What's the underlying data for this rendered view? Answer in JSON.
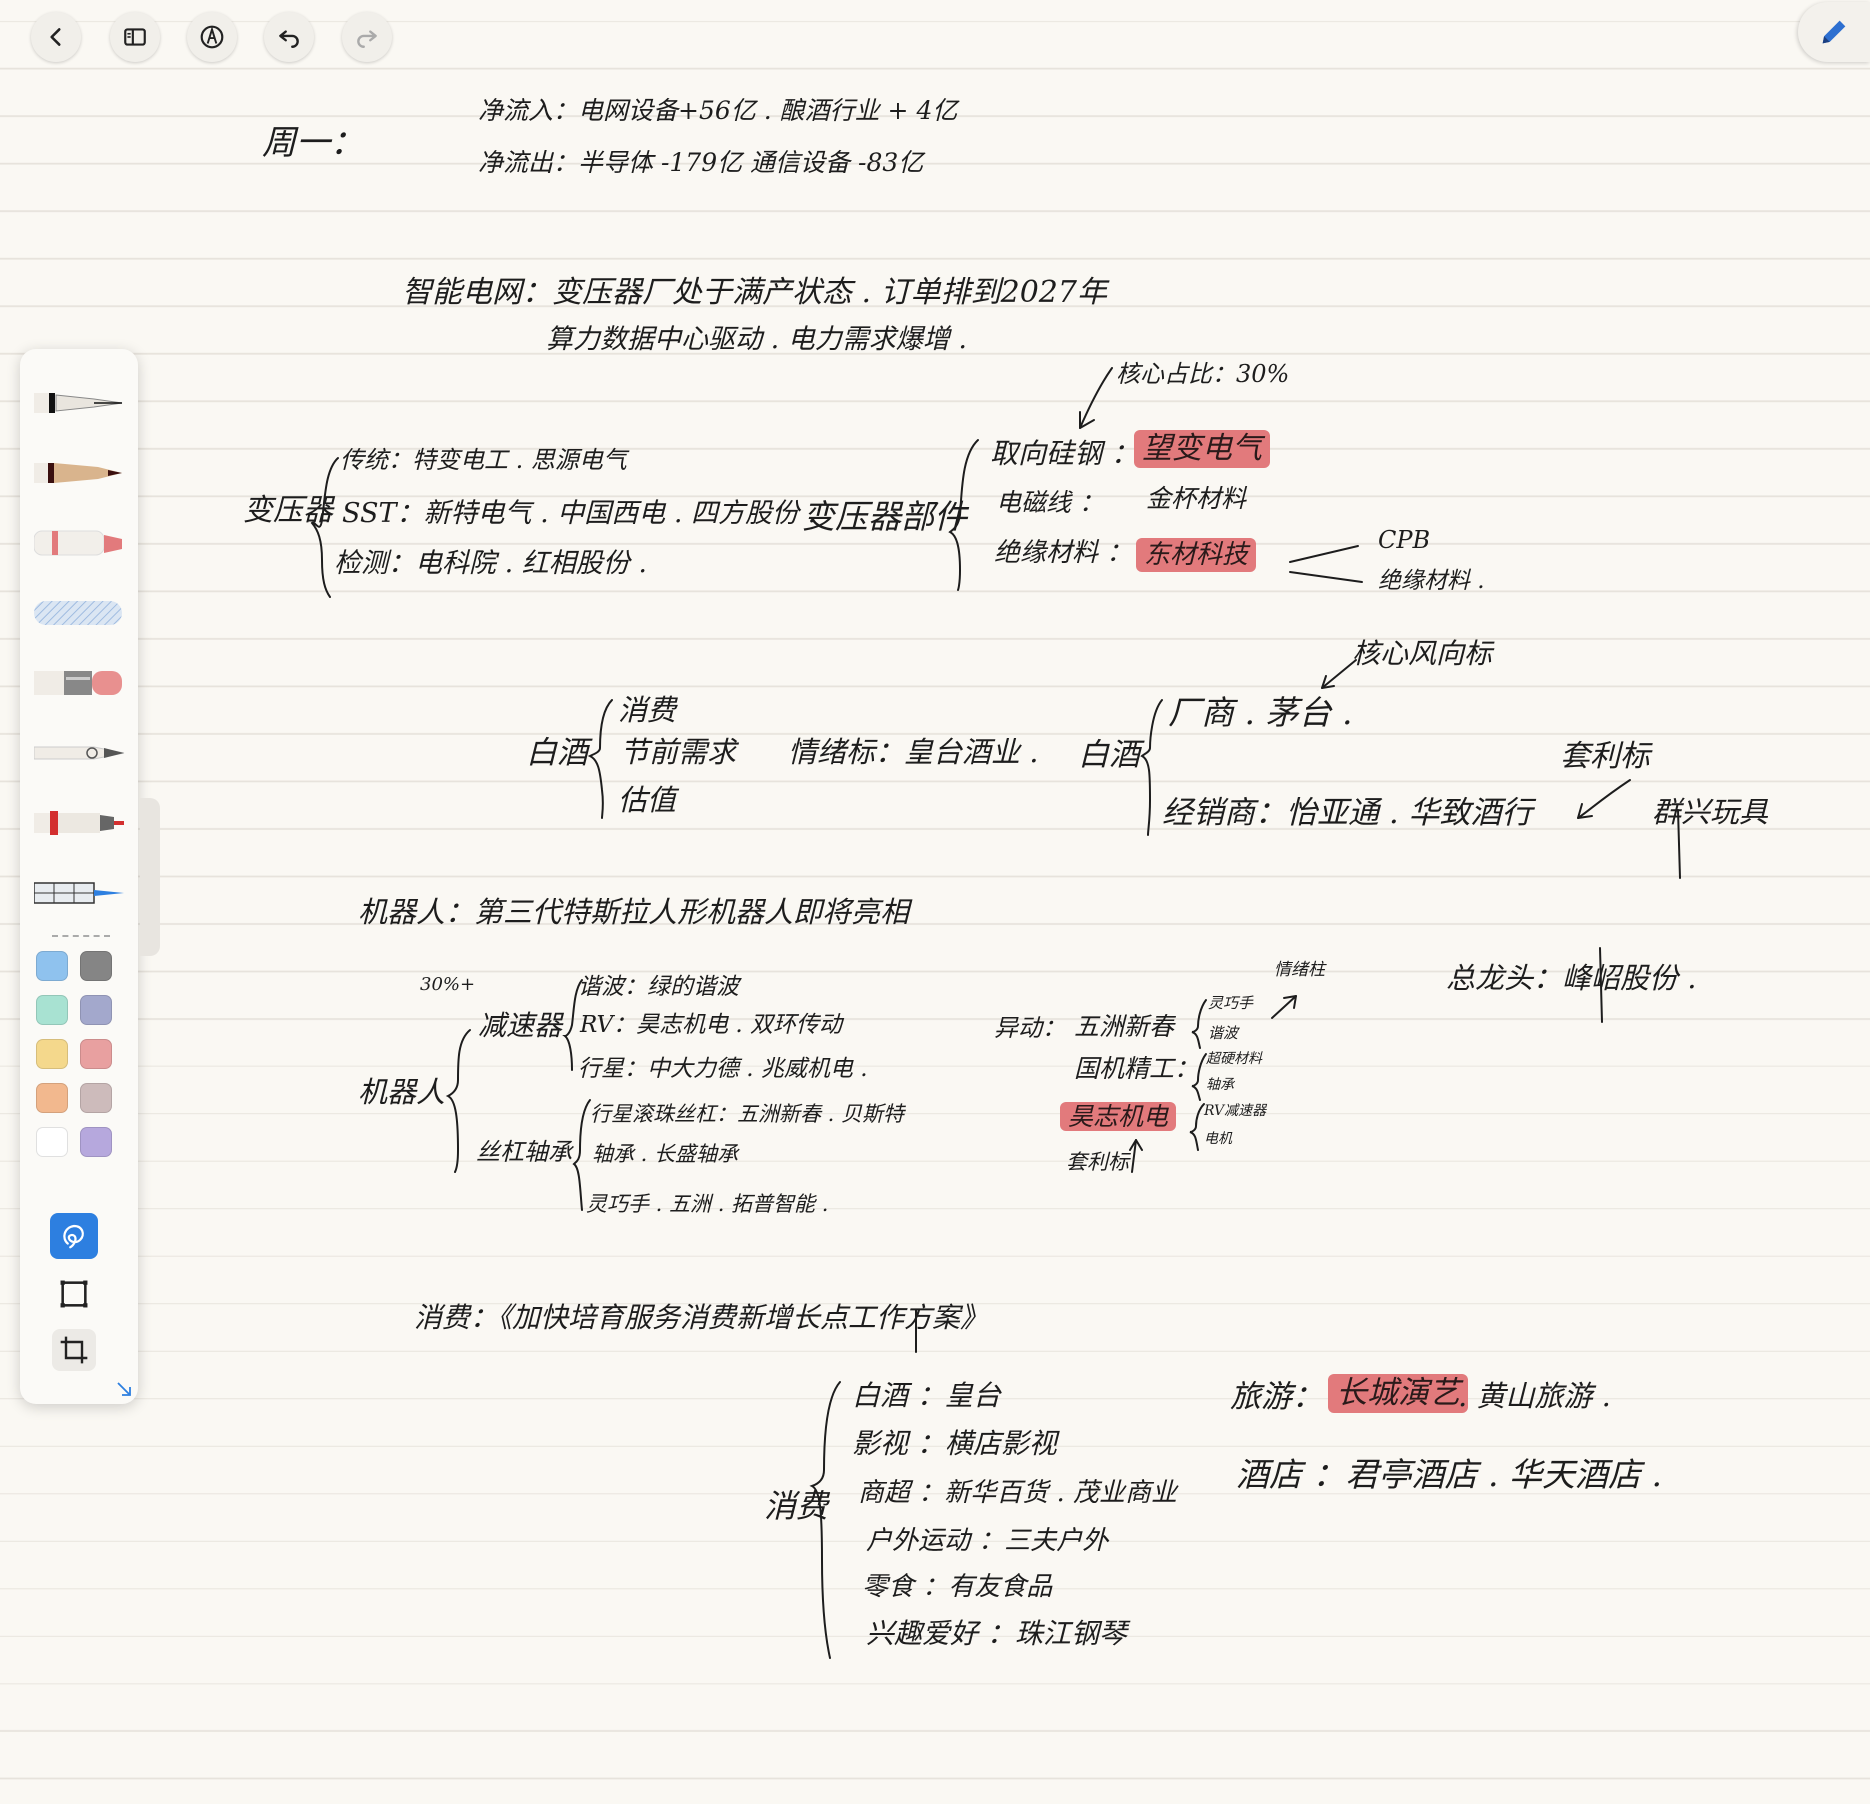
{
  "toolbar": {
    "back_icon": "chevron-left-icon",
    "sidebar_icon": "sidebar-icon",
    "pen_mode_icon": "pen-mode-icon",
    "undo_icon": "undo-icon",
    "redo_icon": "redo-icon",
    "pencil_icon": "pencil-icon"
  },
  "tool_panel": {
    "tools": [
      "fountain-pen-icon",
      "ballpoint-pen-icon",
      "marker-icon",
      "highlighter-icon",
      "eraser-icon",
      "lasso-pen-icon",
      "red-pen-icon",
      "ruler-icon"
    ],
    "swatches": [
      [
        "#8fc2ee",
        "#858585"
      ],
      [
        "#a8e2d2",
        "#a3a8cc"
      ],
      [
        "#f4d88c",
        "#e8a0a0"
      ],
      [
        "#f2b88e",
        "#cdbbbb"
      ],
      [
        "#ffffff",
        "#b6a8dd"
      ]
    ],
    "accent": "#2d7fe0",
    "highlight": "#e27a7c"
  },
  "note": {
    "mon_label": "周一：",
    "inflow": "净流入：电网设备+56亿 . 酿酒行业 + 4亿",
    "outflow": "净流出：半导体 -179亿    通信设备 -83亿",
    "grid_title": "智能电网：变压器厂处于满产状态 . 订单排到2027年",
    "grid_sub": "算力数据中心驱动 . 电力需求爆增 .",
    "transformer": "变压器",
    "trad": "传统：特变电工 . 思源电气",
    "sst": "SST：新特电气 . 中国西电 . 四方股份 .",
    "detect": "检测：电科院 . 红相股份 .",
    "parts": "变压器部件",
    "core_share": "核心占比：30%",
    "silicon_steel": "取向硅钢 ：",
    "silicon_steel_co": "望变电气",
    "em_wire": "电磁线 ：",
    "em_wire_co": "金杯材料",
    "insulation": "绝缘材料 ：",
    "insulation_co": "东材科技",
    "cpb": "CPB",
    "insulation_mat": "绝缘材料 .",
    "baijiu1": "白酒",
    "consume": "消费",
    "festival": "节前需求",
    "valuation": "估值",
    "sentiment": "情绪标：皇台酒业 .",
    "core_vane": "核心风向标",
    "baijiu2": "白酒",
    "maker": "厂商 . 茅台 .",
    "dealer": "经销商：怡亚通 . 华致酒行",
    "arbitrage": "套利标",
    "toy": "群兴玩具",
    "robot_title": "机器人：第三代特斯拉人形机器人即将亮相",
    "pct30": "30%+",
    "reducer": "减速器",
    "harmonic": "谐波：绿的谐波",
    "rv": "RV：昊志机电 . 双环传动",
    "planet": "行星：中大力德 . 兆威机电 .",
    "robot": "机器人",
    "screw": "丝杠轴承",
    "planet_screw": "行星滚珠丝杠：五洲新春 . 贝斯特",
    "bearing": "轴承 . 长盛轴承",
    "dexhand": "灵巧手 . 五洲 . 拓普智能 .",
    "dragon_head": "总龙头：峰岹股份 .",
    "anomaly": "异动：",
    "wzxc": "五洲新春",
    "gjjg": "国机精工：",
    "hzjd": "昊志机电",
    "dexhand2": "灵巧手",
    "harmonic2": "谐波",
    "superhard": "超硬材料",
    "bearing2": "轴承",
    "rv2": "RV减速器",
    "motor": "电机",
    "sentiment_mark": "情绪柱",
    "arbitrage2": "套利标",
    "consume_title": "消费：《加快培育服务消费新增长点工作方案》",
    "consume2": "消费",
    "c_baijiu": "白酒 ：皇台",
    "c_film": "影视 ：横店影视",
    "c_super": "商超 ：新华百货 . 茂业商业",
    "c_outdoor": "户外运动 ：三夫户外",
    "c_snack": "零食 ：有友食品",
    "c_hobby": "兴趣爱好 ：珠江钢琴",
    "travel": "旅游：",
    "travel_co1": "长城演艺",
    "travel_co2": ". 黄山旅游 .",
    "hotel": "酒店 ：君亭酒店 . 华天酒店 ."
  }
}
